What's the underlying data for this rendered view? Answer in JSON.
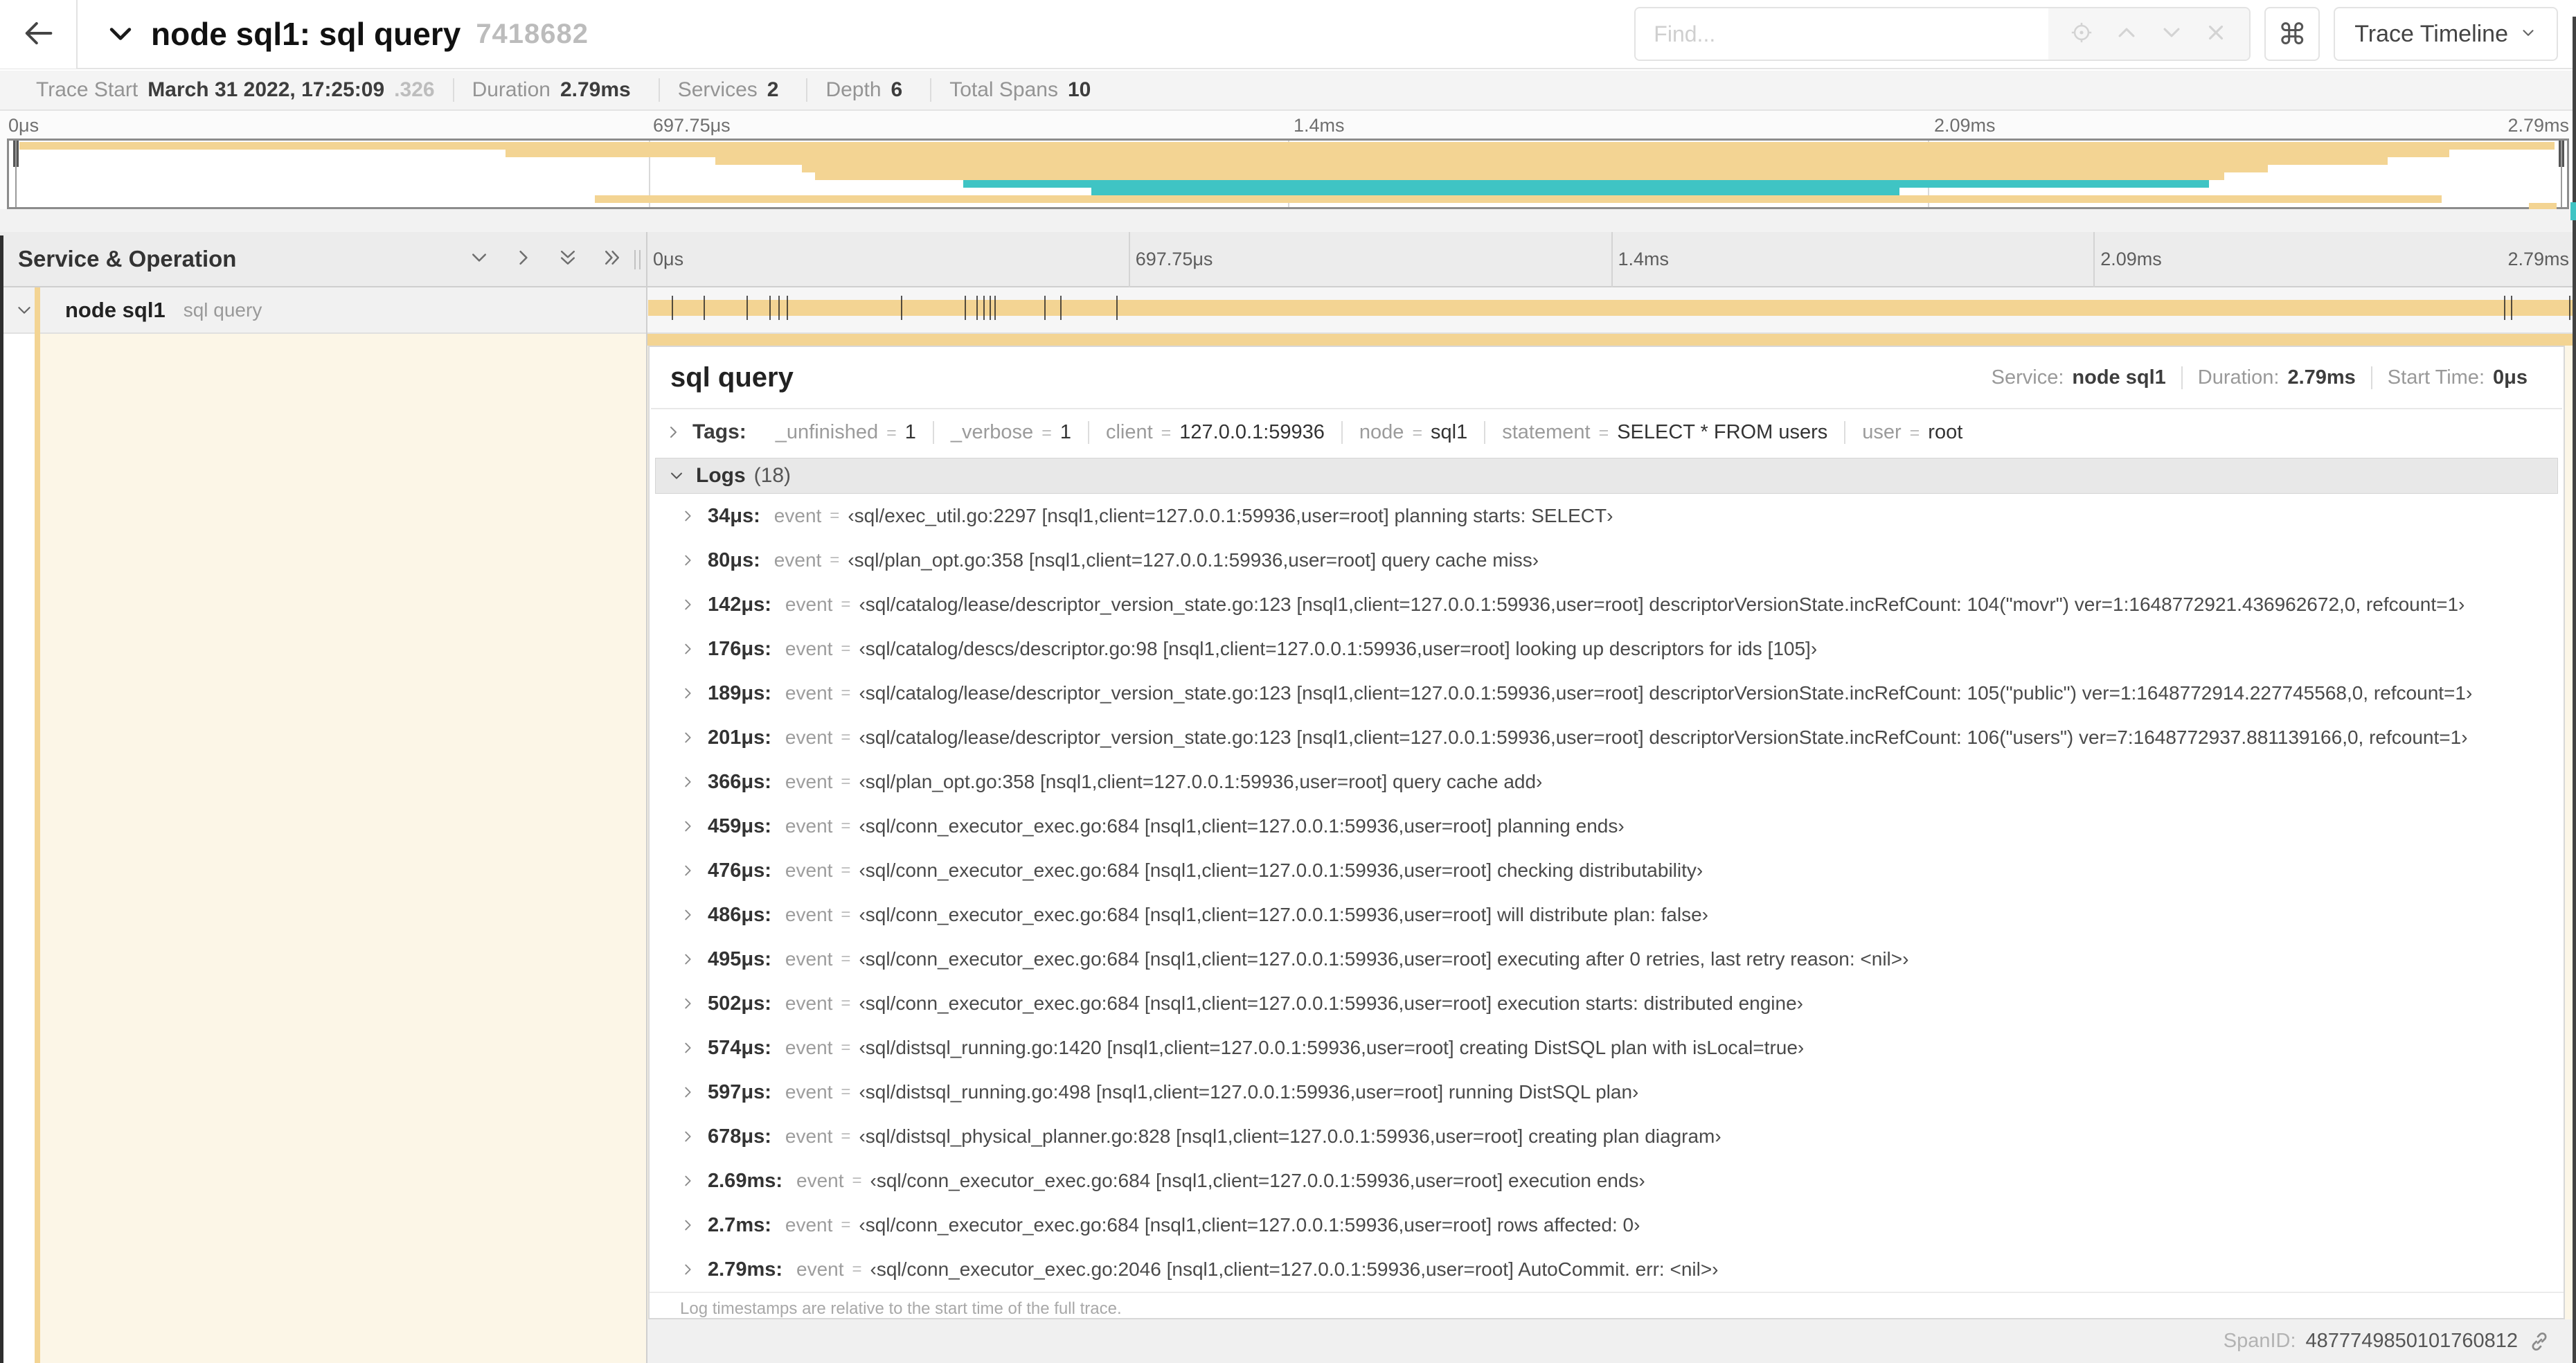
{
  "colors": {
    "tan": "#F3D493",
    "teal": "#3FC4C4"
  },
  "header": {
    "title": "node sql1: sql query",
    "trace_id": "7418682",
    "find_placeholder": "Find...",
    "cmd_symbol": "⌘",
    "trace_timeline_label": "Trace Timeline"
  },
  "trace_info": {
    "items": [
      {
        "label": "Trace Start",
        "value": "March 31 2022, 17:25:09",
        "suffix": ".326"
      },
      {
        "label": "Duration",
        "value": "2.79ms",
        "suffix": ""
      },
      {
        "label": "Services",
        "value": "2",
        "suffix": ""
      },
      {
        "label": "Depth",
        "value": "6",
        "suffix": ""
      },
      {
        "label": "Total Spans",
        "value": "10",
        "suffix": ""
      }
    ]
  },
  "minimap": {
    "ticks": [
      "0μs",
      "697.75μs",
      "1.4ms",
      "2.09ms",
      "2.79ms"
    ],
    "spans": [
      {
        "start": 0.004,
        "end": 0.995,
        "color": "tan"
      },
      {
        "start": 0.194,
        "end": 0.954,
        "color": "tan"
      },
      {
        "start": 0.276,
        "end": 0.93,
        "color": "tan"
      },
      {
        "start": 0.31,
        "end": 0.883,
        "color": "tan"
      },
      {
        "start": 0.315,
        "end": 0.866,
        "color": "tan"
      },
      {
        "start": 0.373,
        "end": 0.86,
        "color": "teal"
      },
      {
        "start": 0.423,
        "end": 0.739,
        "color": "teal"
      },
      {
        "start": 0.229,
        "end": 0.951,
        "color": "tan"
      },
      {
        "start": 0.985,
        "end": 0.996,
        "color": "tan"
      }
    ]
  },
  "timeline": {
    "header_label": "Service & Operation",
    "ticks": [
      "0μs",
      "697.75μs",
      "1.4ms",
      "2.09ms",
      "2.79ms"
    ]
  },
  "span_row": {
    "service": "node sql1",
    "operation": "sql query",
    "log_fractions": [
      0.0122,
      0.0287,
      0.0509,
      0.0631,
      0.0677,
      0.072,
      0.1312,
      0.1645,
      0.1706,
      0.1742,
      0.1774,
      0.1799,
      0.2057,
      0.214,
      0.243,
      0.9642,
      0.9677,
      0.998
    ]
  },
  "detail": {
    "title": "sql query",
    "overview": [
      {
        "label": "Service:",
        "value": "node sql1"
      },
      {
        "label": "Duration:",
        "value": "2.79ms"
      },
      {
        "label": "Start Time:",
        "value": "0μs"
      }
    ],
    "tags_label": "Tags:",
    "tags": [
      {
        "key": "_unfinished",
        "value": "1"
      },
      {
        "key": "_verbose",
        "value": "1"
      },
      {
        "key": "client",
        "value": "127.0.0.1:59936"
      },
      {
        "key": "node",
        "value": "sql1"
      },
      {
        "key": "statement",
        "value": "SELECT * FROM users"
      },
      {
        "key": "user",
        "value": "root"
      }
    ],
    "logs_label": "Logs",
    "logs_count": "(18)",
    "log_key": "event",
    "logs": [
      {
        "time": "34μs:",
        "value": "‹sql/exec_util.go:2297 [nsql1,client=127.0.0.1:59936,user=root] planning starts: SELECT›"
      },
      {
        "time": "80μs:",
        "value": "‹sql/plan_opt.go:358 [nsql1,client=127.0.0.1:59936,user=root] query cache miss›"
      },
      {
        "time": "142μs:",
        "value": "‹sql/catalog/lease/descriptor_version_state.go:123 [nsql1,client=127.0.0.1:59936,user=root] descriptorVersionState.incRefCount: 104(\"movr\") ver=1:1648772921.436962672,0, refcount=1›"
      },
      {
        "time": "176μs:",
        "value": "‹sql/catalog/descs/descriptor.go:98 [nsql1,client=127.0.0.1:59936,user=root] looking up descriptors for ids [105]›"
      },
      {
        "time": "189μs:",
        "value": "‹sql/catalog/lease/descriptor_version_state.go:123 [nsql1,client=127.0.0.1:59936,user=root] descriptorVersionState.incRefCount: 105(\"public\") ver=1:1648772914.227745568,0, refcount=1›"
      },
      {
        "time": "201μs:",
        "value": "‹sql/catalog/lease/descriptor_version_state.go:123 [nsql1,client=127.0.0.1:59936,user=root] descriptorVersionState.incRefCount: 106(\"users\") ver=7:1648772937.881139166,0, refcount=1›"
      },
      {
        "time": "366μs:",
        "value": "‹sql/plan_opt.go:358 [nsql1,client=127.0.0.1:59936,user=root] query cache add›"
      },
      {
        "time": "459μs:",
        "value": "‹sql/conn_executor_exec.go:684 [nsql1,client=127.0.0.1:59936,user=root] planning ends›"
      },
      {
        "time": "476μs:",
        "value": "‹sql/conn_executor_exec.go:684 [nsql1,client=127.0.0.1:59936,user=root] checking distributability›"
      },
      {
        "time": "486μs:",
        "value": "‹sql/conn_executor_exec.go:684 [nsql1,client=127.0.0.1:59936,user=root] will distribute plan: false›"
      },
      {
        "time": "495μs:",
        "value": "‹sql/conn_executor_exec.go:684 [nsql1,client=127.0.0.1:59936,user=root] executing after 0 retries, last retry reason: <nil>›"
      },
      {
        "time": "502μs:",
        "value": "‹sql/conn_executor_exec.go:684 [nsql1,client=127.0.0.1:59936,user=root] execution starts: distributed engine›"
      },
      {
        "time": "574μs:",
        "value": "‹sql/distsql_running.go:1420 [nsql1,client=127.0.0.1:59936,user=root] creating DistSQL plan with isLocal=true›"
      },
      {
        "time": "597μs:",
        "value": "‹sql/distsql_running.go:498 [nsql1,client=127.0.0.1:59936,user=root] running DistSQL plan›"
      },
      {
        "time": "678μs:",
        "value": "‹sql/distsql_physical_planner.go:828 [nsql1,client=127.0.0.1:59936,user=root] creating plan diagram›"
      },
      {
        "time": "2.69ms:",
        "value": "‹sql/conn_executor_exec.go:684 [nsql1,client=127.0.0.1:59936,user=root] execution ends›"
      },
      {
        "time": "2.7ms:",
        "value": "‹sql/conn_executor_exec.go:684 [nsql1,client=127.0.0.1:59936,user=root] rows affected: 0›"
      },
      {
        "time": "2.79ms:",
        "value": "‹sql/conn_executor_exec.go:2046 [nsql1,client=127.0.0.1:59936,user=root] AutoCommit. err: <nil>›"
      }
    ],
    "footnote": "Log timestamps are relative to the start time of the full trace.",
    "span_id_label": "SpanID:",
    "span_id": "4877749850101760812"
  }
}
